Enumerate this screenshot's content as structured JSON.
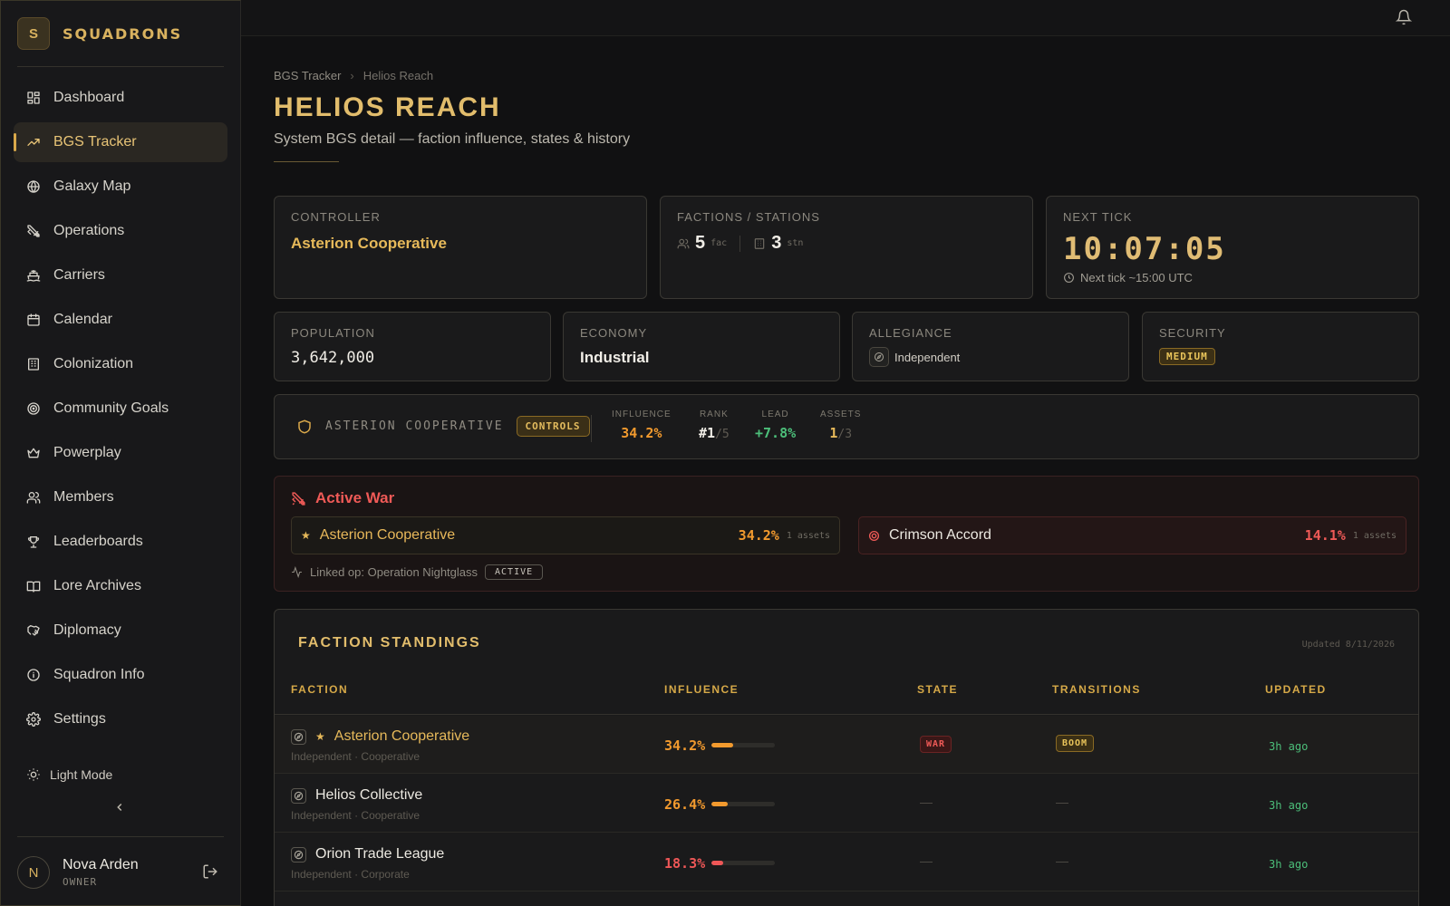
{
  "brand": {
    "logo_letter": "S",
    "name": "SQUADRONS"
  },
  "nav": [
    {
      "label": "Dashboard",
      "icon": "dashboard-icon",
      "active": false
    },
    {
      "label": "BGS Tracker",
      "icon": "trending-up-icon",
      "active": true
    },
    {
      "label": "Galaxy Map",
      "icon": "globe-icon",
      "active": false
    },
    {
      "label": "Operations",
      "icon": "crossed-swords-icon",
      "active": false
    },
    {
      "label": "Carriers",
      "icon": "ship-icon",
      "active": false
    },
    {
      "label": "Calendar",
      "icon": "calendar-icon",
      "active": false
    },
    {
      "label": "Colonization",
      "icon": "building-icon",
      "active": false
    },
    {
      "label": "Community Goals",
      "icon": "target-icon",
      "active": false
    },
    {
      "label": "Powerplay",
      "icon": "crown-icon",
      "active": false
    },
    {
      "label": "Members",
      "icon": "users-icon",
      "active": false
    },
    {
      "label": "Leaderboards",
      "icon": "trophy-icon",
      "active": false
    },
    {
      "label": "Lore Archives",
      "icon": "book-icon",
      "active": false
    },
    {
      "label": "Diplomacy",
      "icon": "handshake-icon",
      "active": false
    },
    {
      "label": "Squadron Info",
      "icon": "info-icon",
      "active": false
    },
    {
      "label": "Settings",
      "icon": "gear-icon",
      "active": false
    }
  ],
  "sidebar": {
    "light_mode": "Light Mode"
  },
  "user": {
    "initial": "N",
    "name": "Nova Arden",
    "role": "OWNER"
  },
  "breadcrumb": {
    "root": "BGS Tracker",
    "current": "Helios Reach"
  },
  "page": {
    "title": "HELIOS REACH",
    "subtitle": "System BGS detail — faction influence, states & history"
  },
  "controller": {
    "label": "CONTROLLER",
    "value": "Asterion Cooperative"
  },
  "factions_stations": {
    "label": "FACTIONS / STATIONS",
    "factions": "5",
    "factions_unit": "fac",
    "stations": "3",
    "stations_unit": "stn"
  },
  "next_tick": {
    "label": "NEXT TICK",
    "countdown": "10:07:05",
    "note": "Next tick ~15:00 UTC"
  },
  "population": {
    "label": "POPULATION",
    "value": "3,642,000"
  },
  "economy": {
    "label": "ECONOMY",
    "value": "Industrial"
  },
  "allegiance": {
    "label": "ALLEGIANCE",
    "value": "Independent"
  },
  "security": {
    "label": "SECURITY",
    "value": "MEDIUM"
  },
  "control_bar": {
    "faction": "ASTERION COOPERATIVE",
    "badge": "CONTROLS",
    "influence_label": "INFLUENCE",
    "influence": "34.2%",
    "rank_label": "RANK",
    "rank": "#1",
    "rank_of": "/5",
    "lead_label": "LEAD",
    "lead": "+7.8%",
    "assets_label": "ASSETS",
    "assets": "1",
    "assets_of": "/3"
  },
  "war": {
    "title": "Active War",
    "left": {
      "name": "Asterion Cooperative",
      "pct": "34.2%",
      "assets": "1 assets"
    },
    "right": {
      "name": "Crimson Accord",
      "pct": "14.1%",
      "assets": "1 assets"
    },
    "linked": "Linked op: Operation Nightglass",
    "linked_status": "ACTIVE"
  },
  "standings": {
    "title": "FACTION STANDINGS",
    "updated": "Updated 8/11/2026",
    "columns": {
      "faction": "FACTION",
      "influence": "INFLUENCE",
      "state": "STATE",
      "transitions": "TRANSITIONS",
      "updated": "UPDATED"
    },
    "rows": [
      {
        "name": "Asterion Cooperative",
        "star": "★",
        "sub": "Independent · Cooperative",
        "influence": "34.2%",
        "influence_value": 34.2,
        "state": "WAR",
        "transition": "BOOM",
        "updated": "3h ago",
        "color": "#f29a2e"
      },
      {
        "name": "Helios Collective",
        "star": "",
        "sub": "Independent · Cooperative",
        "influence": "26.4%",
        "influence_value": 26.4,
        "state": "—",
        "transition": "—",
        "updated": "3h ago",
        "color": "#f29a2e"
      },
      {
        "name": "Orion Trade League",
        "star": "",
        "sub": "Independent · Corporate",
        "influence": "18.3%",
        "influence_value": 18.3,
        "state": "—",
        "transition": "—",
        "updated": "3h ago",
        "color": "#ee5757"
      }
    ]
  },
  "colors": {
    "accent": "#e2bd6c",
    "danger": "#ef5a57",
    "positive": "#4cbf7a",
    "orange": "#f29a2e"
  }
}
